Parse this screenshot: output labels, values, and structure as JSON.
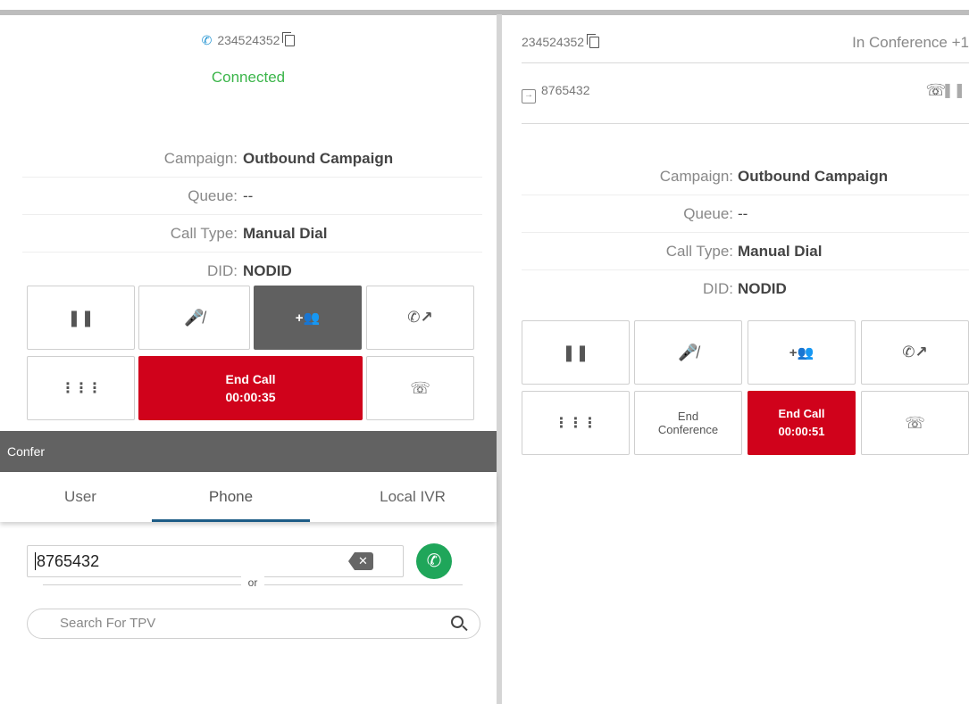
{
  "left": {
    "phone_number": "234524352",
    "status": "Connected",
    "info": [
      {
        "label": "Campaign:",
        "value": "Outbound Campaign"
      },
      {
        "label": "Queue:",
        "value": "--"
      },
      {
        "label": "Call Type:",
        "value": "Manual Dial"
      },
      {
        "label": "DID:",
        "value": "NODID"
      }
    ],
    "end_call": {
      "label": "End Call",
      "timer": "00:00:35"
    },
    "confer": {
      "title": "Confer",
      "tabs": [
        "User",
        "Phone",
        "Local IVR"
      ],
      "active_tab": "Phone",
      "dial_value": "8765432",
      "or_text": "or",
      "search_placeholder": "Search For TPV"
    }
  },
  "right": {
    "phone_number": "234524352",
    "conference_status": "In Conference +1",
    "leg_number": "8765432",
    "info": [
      {
        "label": "Campaign:",
        "value": "Outbound Campaign"
      },
      {
        "label": "Queue:",
        "value": "--"
      },
      {
        "label": "Call Type:",
        "value": "Manual Dial"
      },
      {
        "label": "DID:",
        "value": "NODID"
      }
    ],
    "end_conference": {
      "line1": "End",
      "line2": "Conference"
    },
    "end_call": {
      "label": "End Call",
      "timer": "00:00:51"
    }
  },
  "icons": {
    "phone": "phone-icon",
    "copy": "copy-icon",
    "hold": "hold-icon",
    "mute": "mute-icon",
    "conference": "add-participant-icon",
    "transfer": "call-transfer-icon",
    "keypad": "keypad-icon",
    "park": "park-call-icon",
    "clear": "backspace-icon",
    "call": "call-icon",
    "search": "search-icon",
    "leg_join": "join-icon",
    "hangup": "hangup-icon"
  },
  "colors": {
    "connected": "#3bb54a",
    "end_call": "#d0021b",
    "active_button": "#606060",
    "call_button": "#1fa65a",
    "phone_icon": "#1a8fd0",
    "tab_underline": "#1d5c86"
  }
}
